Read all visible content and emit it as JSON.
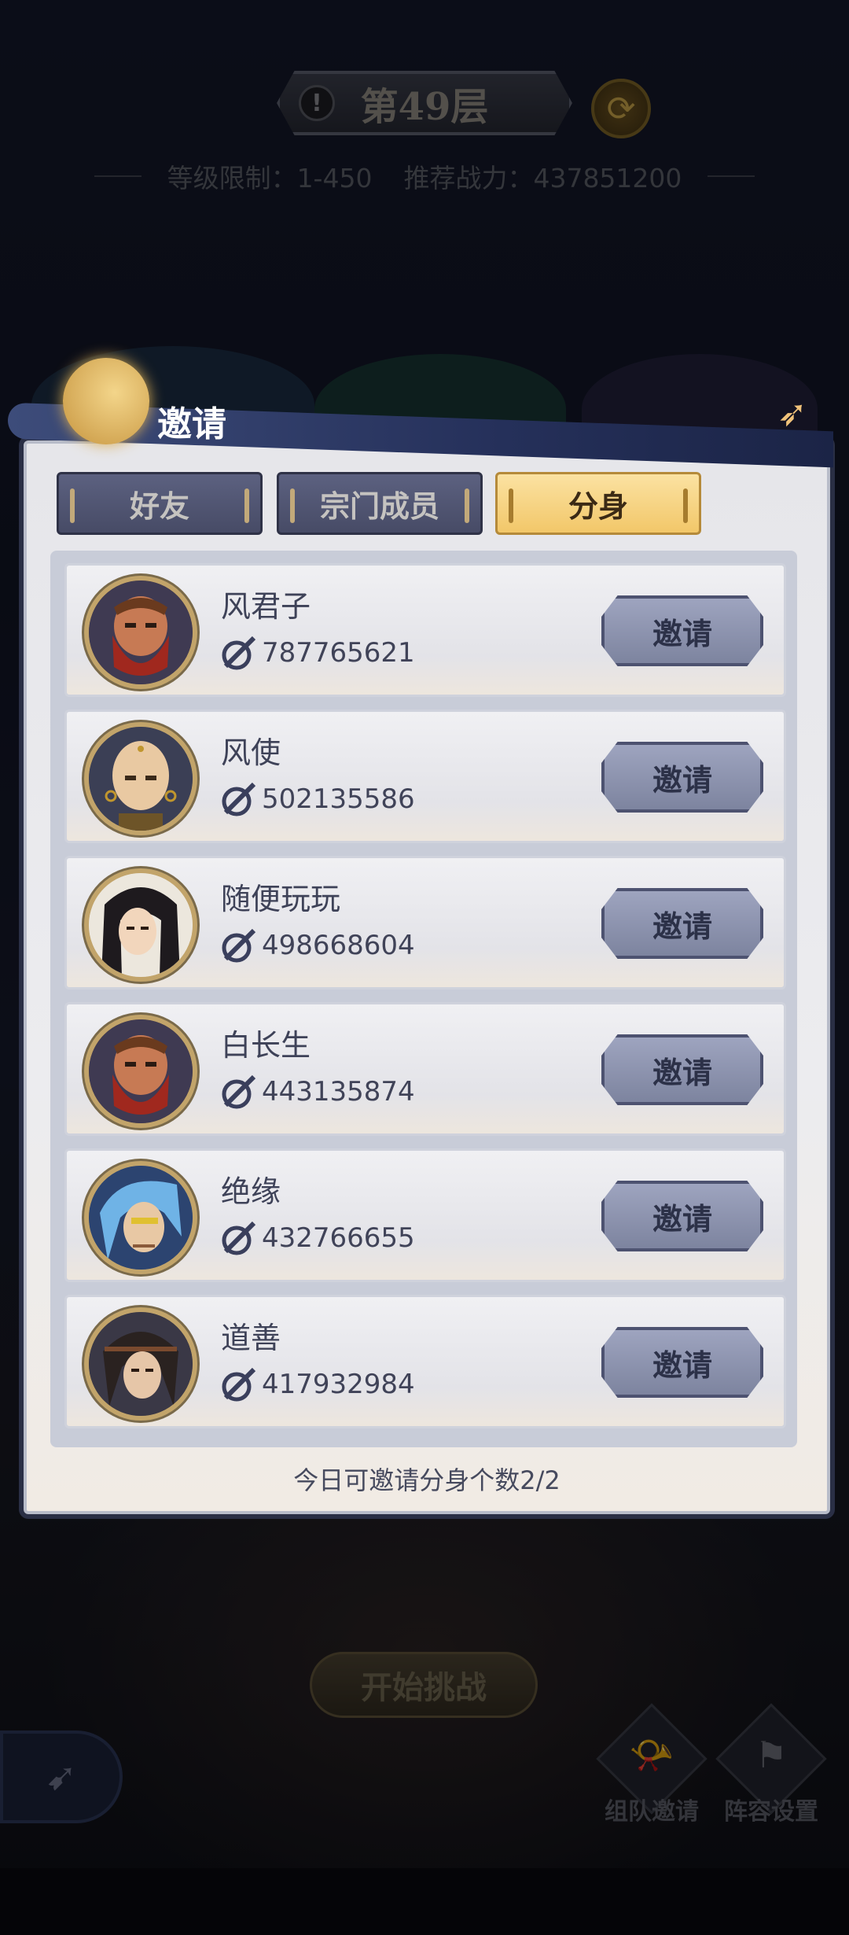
{
  "floor": {
    "title": "第49层",
    "level_limit": "等级限制：1-450",
    "recommended_power": "推荐战力：437851200"
  },
  "dialog": {
    "title": "邀请",
    "tabs": [
      {
        "label": "好友",
        "active": false
      },
      {
        "label": "宗门成员",
        "active": false
      },
      {
        "label": "分身",
        "active": true
      }
    ],
    "invite_label": "邀请",
    "entries": [
      {
        "name": "风君子",
        "power": "787765621",
        "avatar": "red-bearded-warrior-avatar"
      },
      {
        "name": "风使",
        "power": "502135586",
        "avatar": "bald-monk-avatar"
      },
      {
        "name": "随便玩玩",
        "power": "498668604",
        "avatar": "long-haired-scholar-avatar"
      },
      {
        "name": "白长生",
        "power": "443135874",
        "avatar": "red-bearded-warrior-avatar"
      },
      {
        "name": "绝缘",
        "power": "432766655",
        "avatar": "blue-haired-warrior-avatar"
      },
      {
        "name": "道善",
        "power": "417932984",
        "avatar": "dark-haired-swordsman-avatar"
      }
    ],
    "footer_note": "今日可邀请分身个数2/2"
  },
  "background_ui": {
    "start_button": "开始挑战",
    "team_invite": "组队邀请",
    "lineup_settings": "阵容设置"
  },
  "colors": {
    "tab_active": "#f2c769",
    "tab_inactive": "#4f5470",
    "invite_button": "#8c92ad"
  }
}
